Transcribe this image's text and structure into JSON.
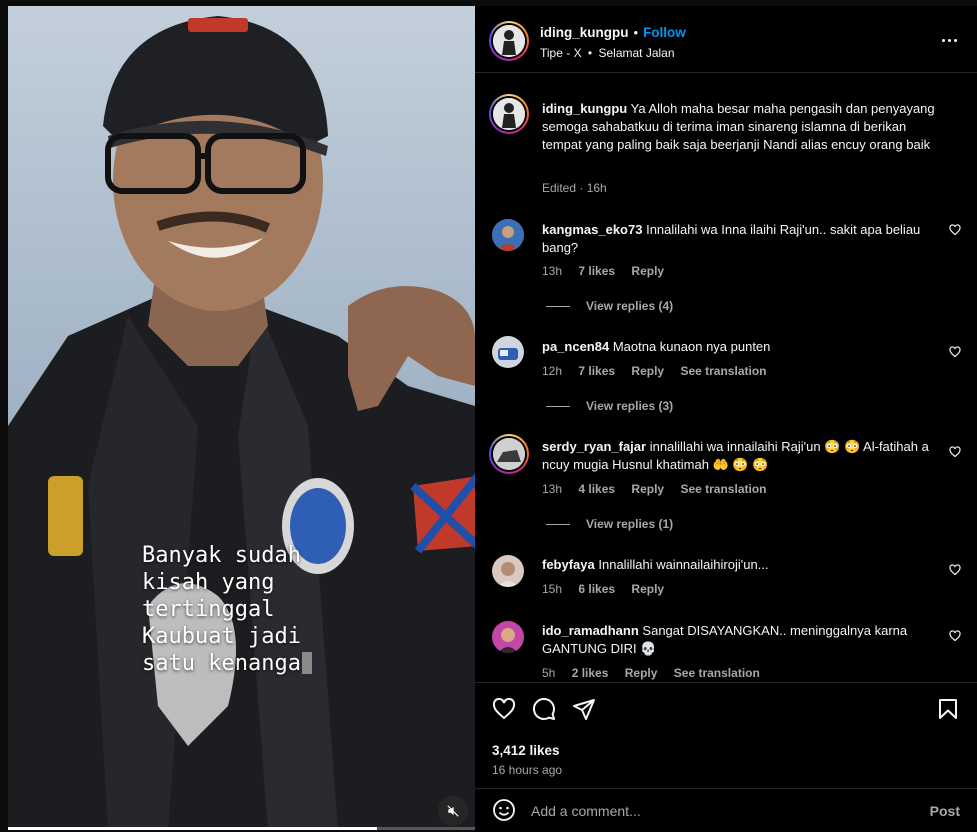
{
  "media": {
    "caption_lines": [
      "Banyak sudah",
      "kisah yang",
      "tertinggal",
      "Kaubuat jadi",
      "satu kenanga"
    ],
    "mute_icon": "speaker-muted-icon",
    "progress": 0.79
  },
  "post": {
    "username": "iding_kungpu",
    "follow_label": "Follow",
    "dot": "•",
    "audio": "Tipe - X",
    "audio_sep": "•",
    "audio_track": "Selamat Jalan"
  },
  "caption": {
    "username": "iding_kungpu",
    "text": "Ya Alloh maha besar maha pengasih dan penyayang semoga sahabatkuu di terima iman sinareng islamna di berikan tempat yang paling baik saja beerjanji Nandi alias encuy orang baik",
    "meta": "Edited · 16h"
  },
  "comments": [
    {
      "username": "kangmas_eko73",
      "text": "Innalilahi wa Inna ilaihi Raji'un.. sakit apa beliau bang?",
      "time": "13h",
      "likes": "7 likes",
      "reply": "Reply",
      "translate": "",
      "view_replies": "View replies (4)"
    },
    {
      "username": "pa_ncen84",
      "text": "Maotna kunaon nya punten",
      "time": "12h",
      "likes": "7 likes",
      "reply": "Reply",
      "translate": "See translation",
      "view_replies": "View replies (3)"
    },
    {
      "username": "serdy_ryan_fajar",
      "text": "innalillahi wa innailaihi Raji'un 😳 😳 Al-fatihah a ncuy mugia Husnul khatimah 🤲 😳 😳",
      "time": "13h",
      "likes": "4 likes",
      "reply": "Reply",
      "translate": "See translation",
      "view_replies": "View replies (1)"
    },
    {
      "username": "febyfaya",
      "text": "Innalillahi wainnailaihiroji'un...",
      "time": "15h",
      "likes": "6 likes",
      "reply": "Reply",
      "translate": "",
      "view_replies": ""
    },
    {
      "username": "ido_ramadhann",
      "text": "Sangat DISAYANGKAN.. meninggalnya karna GANTUNG DIRI 💀",
      "time": "5h",
      "likes": "2 likes",
      "reply": "Reply",
      "translate": "See translation",
      "view_replies": ""
    }
  ],
  "footer": {
    "likes": "3,412 likes",
    "time": "16 hours ago",
    "comment_placeholder": "Add a comment...",
    "post_label": "Post"
  },
  "icons": {
    "like": "heart-icon",
    "comment": "comment-icon",
    "share": "send-icon",
    "save": "bookmark-icon",
    "emoji": "emoji-icon",
    "more": "more-options-icon"
  }
}
